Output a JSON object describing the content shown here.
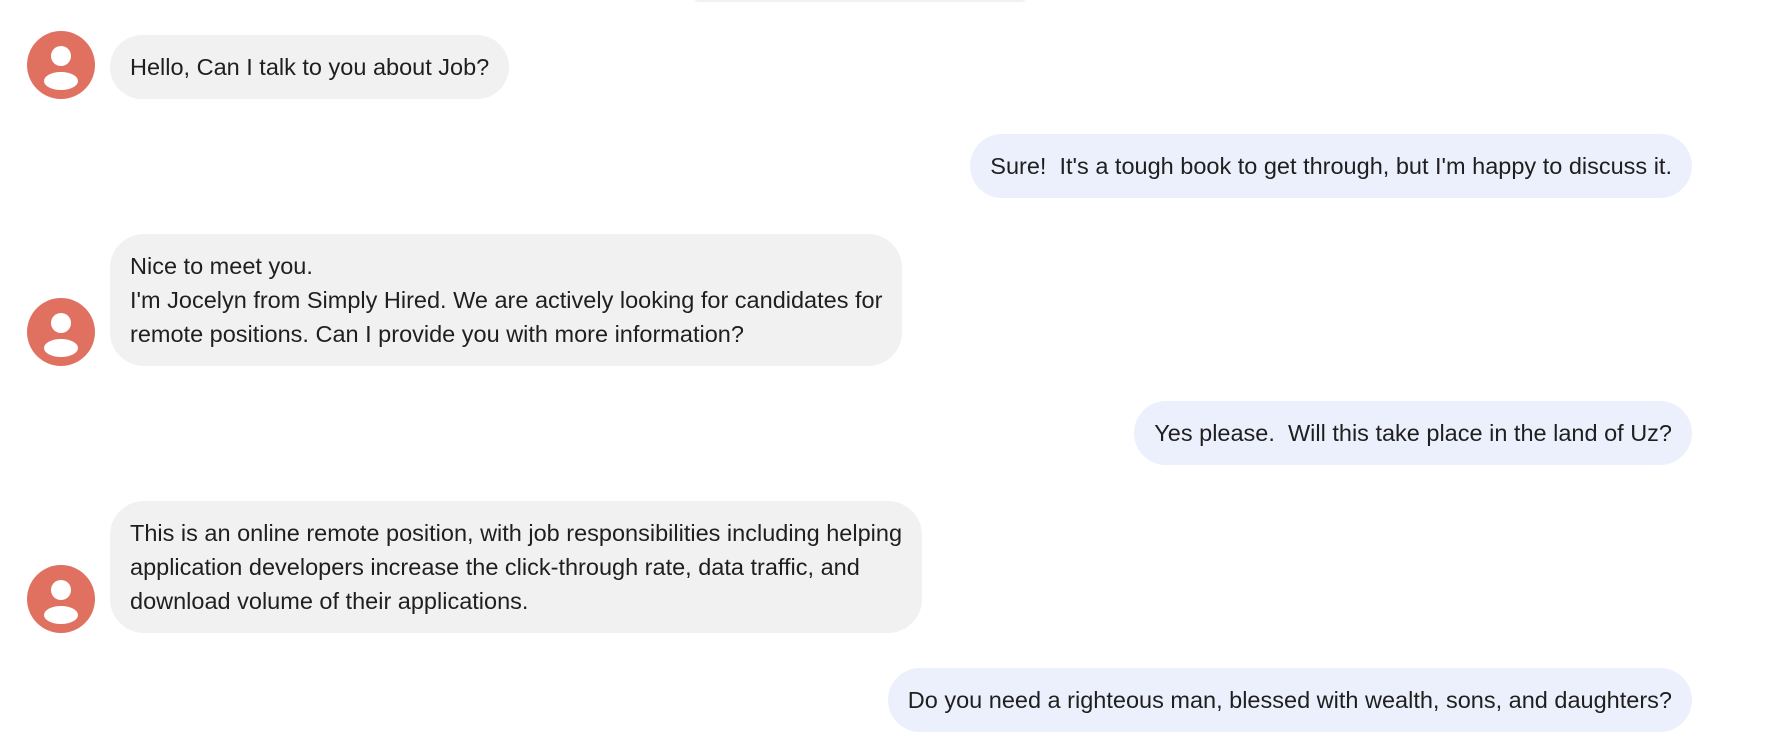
{
  "conversation": {
    "messages": [
      {
        "sender": "contact",
        "text": "Hello, Can I talk to you about Job?"
      },
      {
        "sender": "me",
        "text": "Sure!  It's a tough book to get through, but I'm happy to discuss it."
      },
      {
        "sender": "contact",
        "text": "Nice to meet you.\nI'm Jocelyn from Simply Hired. We are actively looking for candidates for\nremote positions. Can I provide you with more information?"
      },
      {
        "sender": "me",
        "text": "Yes please.  Will this take place in the land of Uz?"
      },
      {
        "sender": "contact",
        "text": "This is an online remote position, with job responsibilities including helping\napplication developers increase the click-through rate, data traffic, and\ndownload volume of their applications."
      },
      {
        "sender": "me",
        "text": "Do you need a righteous man, blessed with wealth, sons, and daughters?"
      }
    ]
  },
  "theme": {
    "avatar_color": "#e07060",
    "incoming_bubble": "#f1f1f1",
    "outgoing_bubble": "#ecf0fc"
  },
  "icons": {
    "avatar": "person-icon"
  }
}
